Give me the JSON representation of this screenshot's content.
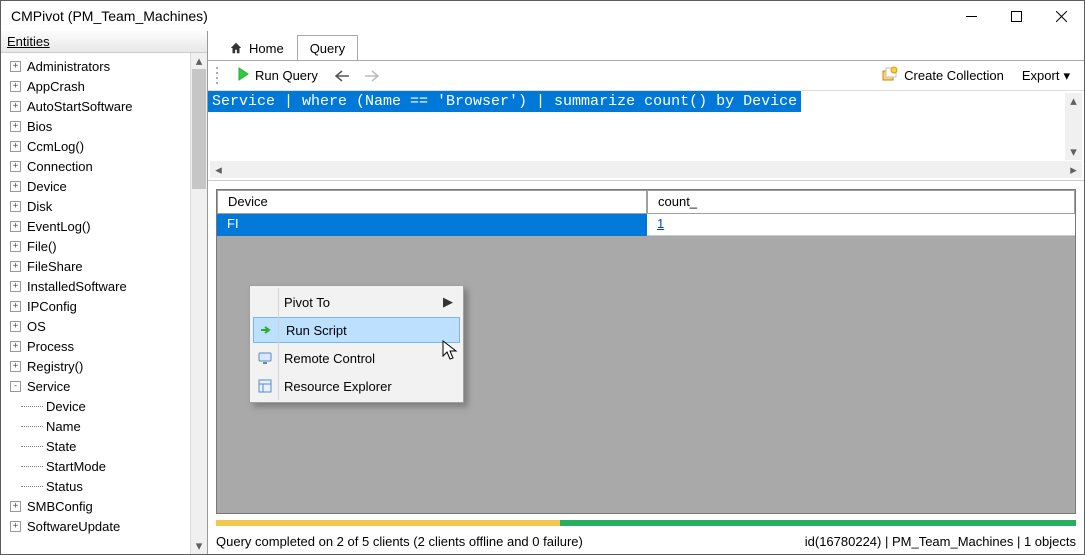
{
  "window_title": "CMPivot (PM_Team_Machines)",
  "entities": {
    "header": "Entities",
    "nodes": [
      {
        "label": "Administrators"
      },
      {
        "label": "AppCrash"
      },
      {
        "label": "AutoStartSoftware"
      },
      {
        "label": "Bios"
      },
      {
        "label": "CcmLog()"
      },
      {
        "label": "Connection"
      },
      {
        "label": "Device"
      },
      {
        "label": "Disk"
      },
      {
        "label": "EventLog()"
      },
      {
        "label": "File()"
      },
      {
        "label": "FileShare"
      },
      {
        "label": "InstalledSoftware"
      },
      {
        "label": "IPConfig"
      },
      {
        "label": "OS"
      },
      {
        "label": "Process"
      },
      {
        "label": "Registry()"
      }
    ],
    "service": {
      "label": "Service",
      "children": [
        {
          "label": "Device"
        },
        {
          "label": "Name"
        },
        {
          "label": "State"
        },
        {
          "label": "StartMode"
        },
        {
          "label": "Status"
        }
      ]
    },
    "tail": [
      {
        "label": "SMBConfig"
      },
      {
        "label": "SoftwareUpdate"
      }
    ]
  },
  "tabs": {
    "home": "Home",
    "query": "Query"
  },
  "toolbar": {
    "run": "Run Query",
    "create": "Create Collection",
    "export": "Export"
  },
  "query_text": "Service | where (Name == 'Browser') | summarize count() by Device",
  "results": {
    "col_device": "Device",
    "col_count": "count_",
    "row_device": "FI",
    "row_count": "1"
  },
  "context_menu": {
    "pivot": "Pivot To",
    "run_script": "Run Script",
    "remote": "Remote Control",
    "resexp": "Resource Explorer"
  },
  "status": {
    "left": "Query completed on 2 of 5 clients (2 clients offline and 0 failure)",
    "right": "id(16780224)  |  PM_Team_Machines  |  1 objects"
  }
}
